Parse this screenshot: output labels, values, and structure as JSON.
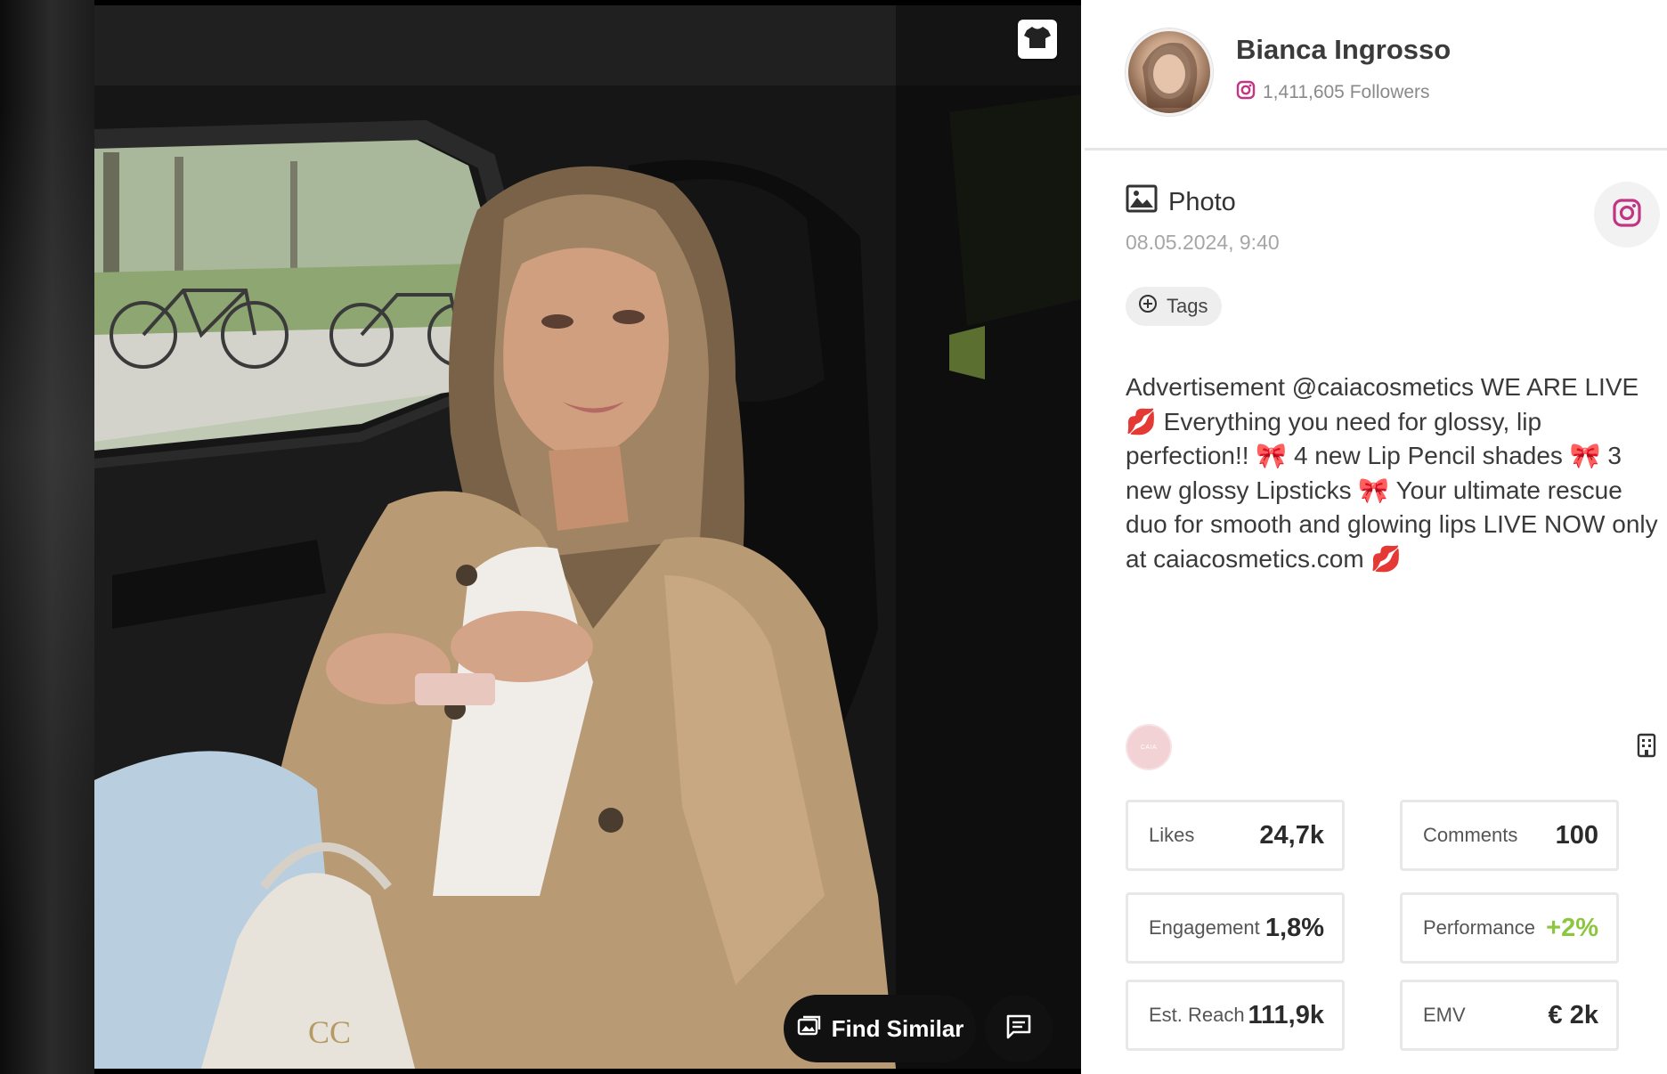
{
  "media": {
    "shirt_icon": "tshirt-icon",
    "find_similar_label": "Find Similar",
    "find_similar_icon": "image-search-icon",
    "comment_icon": "comment-icon"
  },
  "profile": {
    "name": "Bianca Ingrosso",
    "followers": "1,411,605 Followers",
    "platform_icon": "instagram-icon"
  },
  "post": {
    "type": "Photo",
    "type_icon": "image-icon",
    "date": "08.05.2024, 9:40",
    "tags_label": "Tags",
    "tags_icon": "plus-circle-icon",
    "caption": "Advertisement @caiacosmetics WE ARE LIVE 💋 Everything you need for glossy, lip perfection!! 🎀 4 new Lip Pencil shades 🎀 3 new glossy Lipsticks 🎀 Your ultimate rescue duo for smooth and glowing lips LIVE NOW only at caiacosmetics.com 💋",
    "brand_logo_text": "CAIA",
    "building_icon": "building-icon"
  },
  "stats": {
    "likes": {
      "label": "Likes",
      "value": "24,7k"
    },
    "comments": {
      "label": "Comments",
      "value": "100"
    },
    "engagement": {
      "label": "Engagement",
      "value": "1,8%"
    },
    "performance": {
      "label": "Performance",
      "value": "+2%"
    },
    "reach": {
      "label": "Est. Reach",
      "value": "111,9k"
    },
    "emv": {
      "label": "EMV",
      "value": "€ 2k"
    }
  },
  "colors": {
    "instagram": "#c13584",
    "positive": "#8cc63f",
    "dark_button": "#111111"
  }
}
